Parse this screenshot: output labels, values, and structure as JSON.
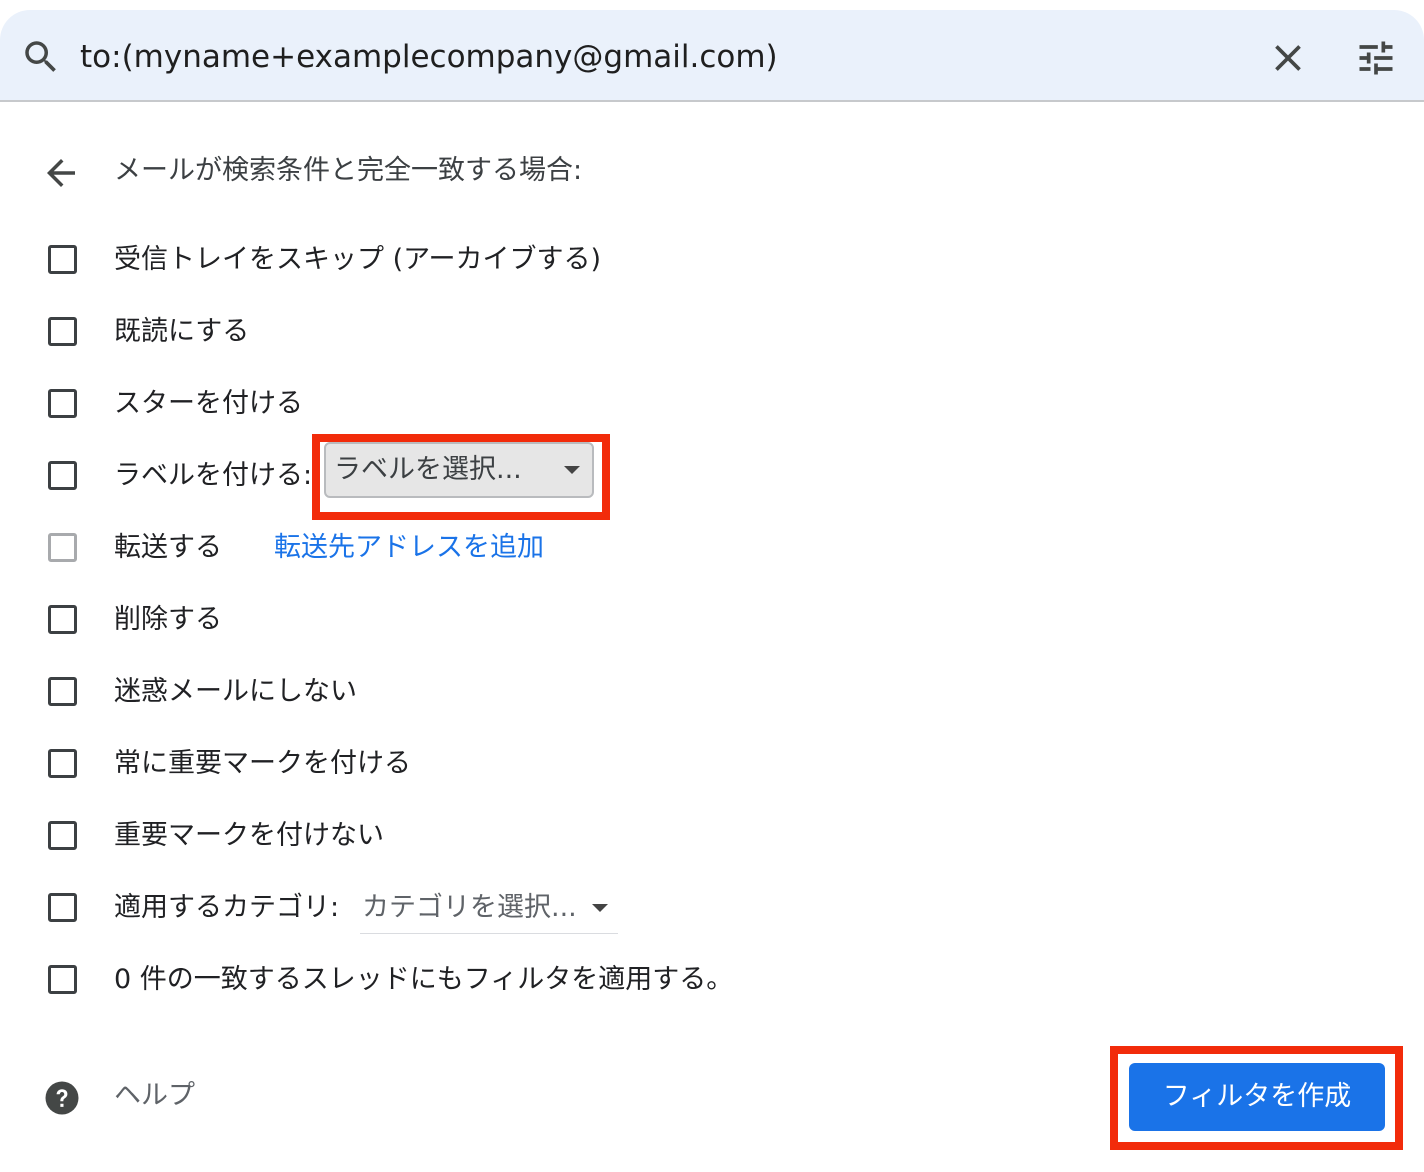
{
  "search": {
    "query": "to:(myname+examplecompany@gmail.com)",
    "search_icon": "search-icon",
    "clear_icon": "close-icon",
    "options_icon": "tune-icon"
  },
  "header": {
    "back_icon": "arrow-back-icon",
    "text": "メールが検索条件と完全一致する場合:"
  },
  "actions": [
    {
      "label": "受信トレイをスキップ (アーカイブする)",
      "checked": false
    },
    {
      "label": "既読にする",
      "checked": false
    },
    {
      "label": "スターを付ける",
      "checked": false
    },
    {
      "label": "ラベルを付ける:",
      "checked": false,
      "select": "ラベルを選択..."
    },
    {
      "label": "転送する",
      "checked": false,
      "disabled": true,
      "link": "転送先アドレスを追加"
    },
    {
      "label": "削除する",
      "checked": false
    },
    {
      "label": "迷惑メールにしない",
      "checked": false
    },
    {
      "label": "常に重要マークを付ける",
      "checked": false
    },
    {
      "label": "重要マークを付けない",
      "checked": false
    },
    {
      "label": "適用するカテゴリ:",
      "checked": false,
      "select": "カテゴリを選択..."
    },
    {
      "label": "0 件の一致するスレッドにもフィルタを適用する。",
      "checked": false
    }
  ],
  "footer": {
    "help_icon": "help-icon",
    "help_label": "ヘルプ",
    "create_button": "フィルタを作成"
  },
  "colors": {
    "accent": "#1a73e8",
    "search_bg": "#eaf1fb",
    "highlight": "#f22b0a"
  }
}
